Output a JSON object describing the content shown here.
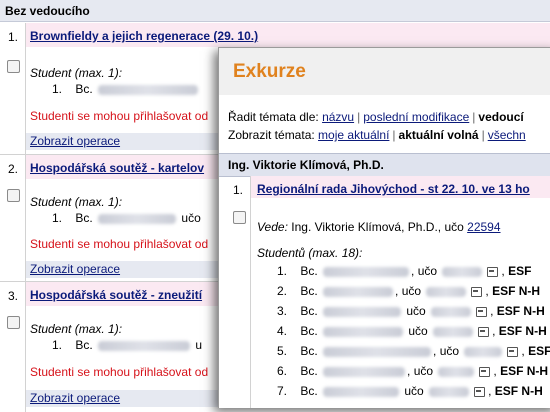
{
  "background": {
    "section_header": "Bez vedoucího",
    "topics": [
      {
        "num": "1.",
        "title": "Brownfieldy a jejich regenerace (29. 10.)",
        "student_label": "Student (max. 1):",
        "row_num": "1.",
        "row_prefix": "Bc.",
        "row_suffix": "",
        "warning": "Studenti se mohou přihlašovat od",
        "ops": "Zobrazit operace"
      },
      {
        "num": "2.",
        "title": "Hospodářská soutěž - kartelov",
        "student_label": "Student (max. 1):",
        "row_num": "1.",
        "row_prefix": "Bc.",
        "row_suffix": "učo",
        "warning": "Studenti se mohou přihlašovat od",
        "ops": "Zobrazit operace"
      },
      {
        "num": "3.",
        "title": "Hospodářská soutěž - zneužití",
        "student_label": "Student (max. 1):",
        "row_num": "1.",
        "row_prefix": "Bc.",
        "row_suffix": "u",
        "warning": "Studenti se mohou přihlašovat od",
        "ops": "Zobrazit operace"
      }
    ]
  },
  "popup": {
    "title": "Exkurze",
    "sort_label": "Řadit témata dle:",
    "sort_options": [
      "názvu",
      "poslední modifikace",
      "vedoucí"
    ],
    "show_label": "Zobrazit témata:",
    "show_options": [
      "moje aktuální",
      "aktuální volná",
      "všechn"
    ],
    "section": "Ing. Viktorie Klímová, Ph.D.",
    "topic": {
      "num": "1.",
      "title": "Regionální rada Jihovýchod - st 22. 10. ve 13 ho",
      "vede_label": "Vede:",
      "vede_name": "Ing. Viktorie Klímová, Ph.D., učo",
      "vede_uco": "22594",
      "students_label": "Studentů (max. 18):",
      "students": [
        {
          "num": "1.",
          "prefix": "Bc.",
          "uco": "učo",
          "program": "ESF"
        },
        {
          "num": "2.",
          "prefix": "Bc.",
          "uco": "učo",
          "program": "ESF N-H"
        },
        {
          "num": "3.",
          "prefix": "Bc.",
          "uco": "učo",
          "program": "ESF N-H"
        },
        {
          "num": "4.",
          "prefix": "Bc.",
          "uco": "učo",
          "program": "ESF N-H"
        },
        {
          "num": "5.",
          "prefix": "Bc.",
          "uco": "učo",
          "program": "ESF"
        },
        {
          "num": "6.",
          "prefix": "Bc.",
          "uco": "učo",
          "program": "ESF N-H"
        },
        {
          "num": "7.",
          "prefix": "Bc.",
          "uco": "učo",
          "program": "ESF N-H"
        }
      ]
    }
  },
  "colors": {
    "accent_title": "#e0821e",
    "link": "#0b1a7a",
    "warning": "#d6121a",
    "header_bg": "#e6e9f1",
    "title_bg": "#fbe9f2"
  }
}
